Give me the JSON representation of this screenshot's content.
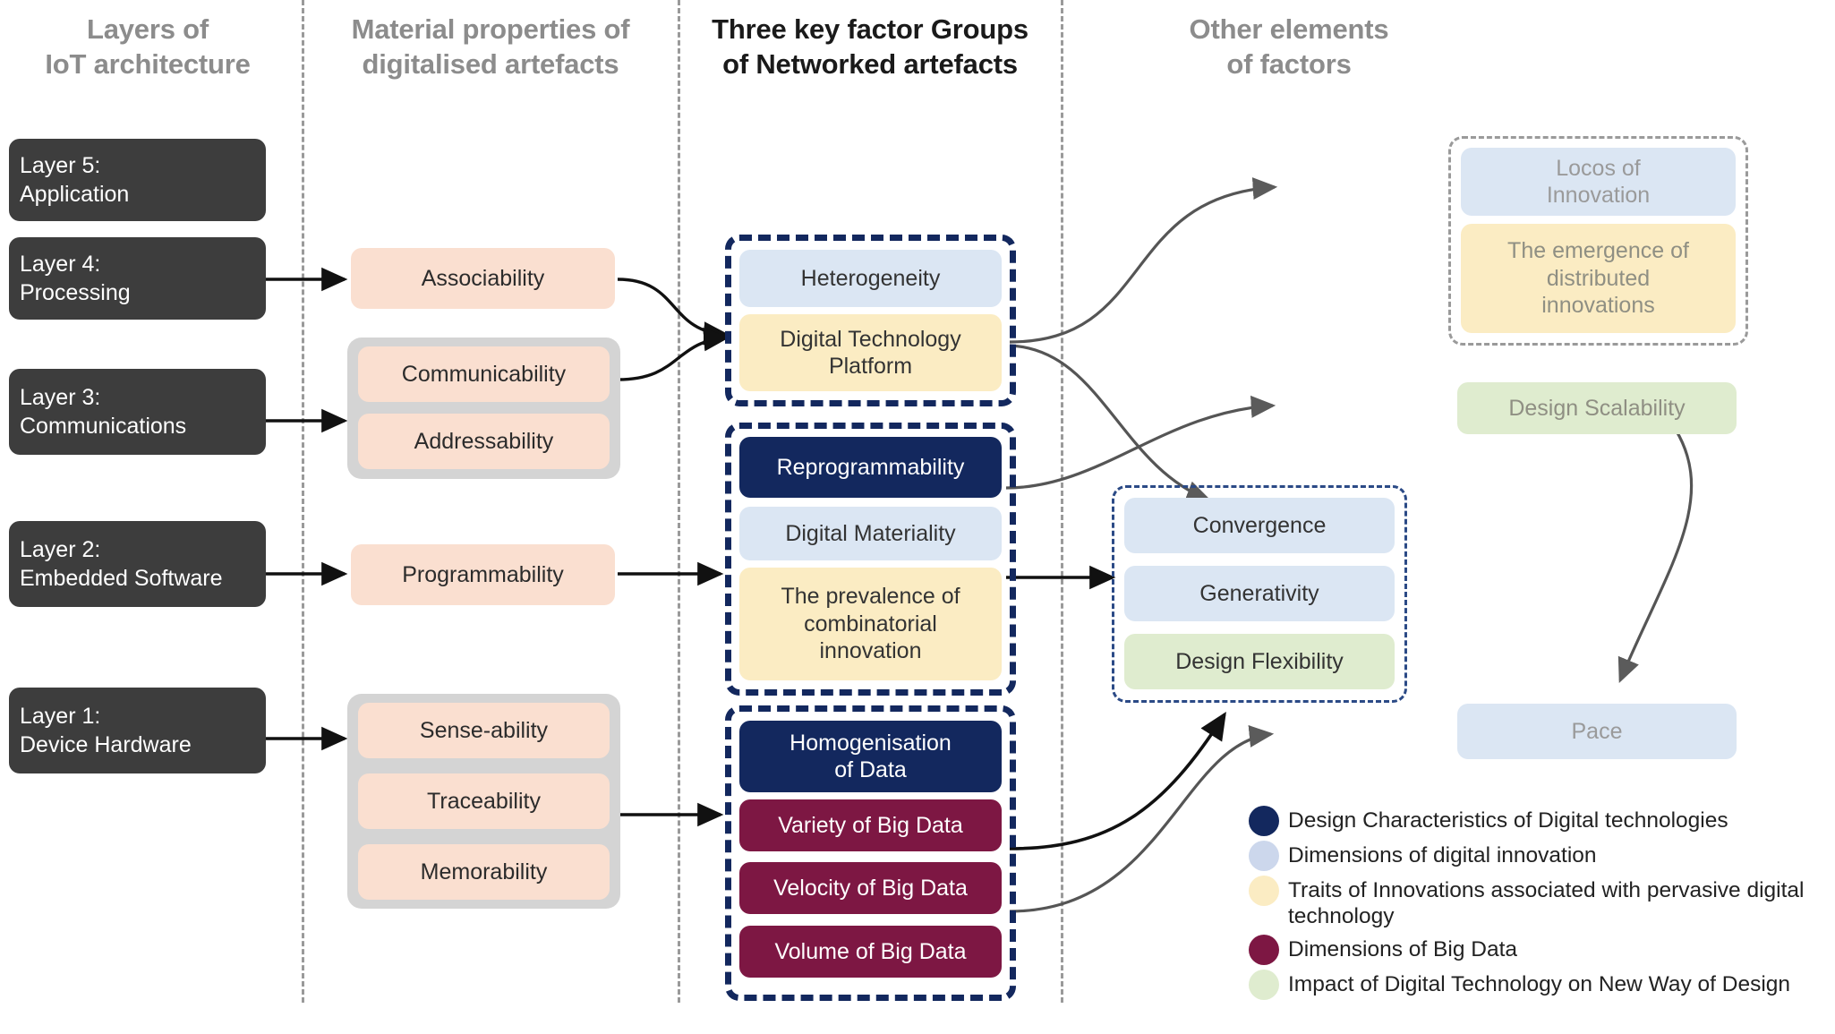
{
  "headers": [
    {
      "id": "layers",
      "label": "Layers of\nIoT architecture",
      "emphasis": "muted"
    },
    {
      "id": "material",
      "label": "Material properties of\ndigitalised artefacts",
      "emphasis": "muted"
    },
    {
      "id": "factors",
      "label": "Three key factor Groups\nof Networked artefacts",
      "emphasis": "strong"
    },
    {
      "id": "other",
      "label": "Other elements\nof factors",
      "emphasis": "muted"
    }
  ],
  "layers": [
    {
      "id": "layer5",
      "title": "Layer 5:",
      "sub": "Application"
    },
    {
      "id": "layer4",
      "title": "Layer 4:",
      "sub": "Processing"
    },
    {
      "id": "layer3",
      "title": "Layer 3:",
      "sub": "Communications"
    },
    {
      "id": "layer2",
      "title": "Layer 2:",
      "sub": "Embedded Software"
    },
    {
      "id": "layer1",
      "title": "Layer 1:",
      "sub": "Device Hardware"
    }
  ],
  "material_properties": [
    {
      "id": "associability",
      "label": "Associability"
    },
    {
      "id": "communicability",
      "label": "Communicability"
    },
    {
      "id": "addressability",
      "label": "Addressability"
    },
    {
      "id": "programmability",
      "label": "Programmability"
    },
    {
      "id": "sense-ability",
      "label": "Sense-ability"
    },
    {
      "id": "traceability",
      "label": "Traceability"
    },
    {
      "id": "memorability",
      "label": "Memorability"
    }
  ],
  "factor_groups": [
    {
      "id": "group1",
      "items": [
        {
          "id": "heterogeneity",
          "label": "Heterogeneity",
          "color": "lightblue"
        },
        {
          "id": "digital-technology-platform",
          "label": "Digital Technology\nPlatform",
          "color": "cream"
        }
      ]
    },
    {
      "id": "group2",
      "items": [
        {
          "id": "reprogrammability",
          "label": "Reprogrammability",
          "color": "navy"
        },
        {
          "id": "digital-materiality",
          "label": "Digital Materiality",
          "color": "lightblue"
        },
        {
          "id": "prevalence-combinatorial-innovation",
          "label": "The prevalence of\ncombinatorial\ninnovation",
          "color": "cream"
        }
      ]
    },
    {
      "id": "group3",
      "items": [
        {
          "id": "homogenisation-of-data",
          "label": "Homogenisation\nof Data",
          "color": "navy"
        },
        {
          "id": "variety-of-big-data",
          "label": "Variety of Big Data",
          "color": "maroon"
        },
        {
          "id": "velocity-of-big-data",
          "label": "Velocity of Big Data",
          "color": "maroon"
        },
        {
          "id": "volume-of-big-data",
          "label": "Volume of Big Data",
          "color": "maroon"
        }
      ]
    }
  ],
  "other_elements": {
    "locos_group": [
      {
        "id": "locos-of-innovation",
        "label": "Locos of\nInnovation",
        "color": "lightblue"
      },
      {
        "id": "emergence-distributed-innovations",
        "label": "The emergence of\ndistributed\ninnovations",
        "color": "cream"
      }
    ],
    "convergence_group": [
      {
        "id": "convergence",
        "label": "Convergence",
        "color": "lightblue"
      },
      {
        "id": "generativity",
        "label": "Generativity",
        "color": "lightblue"
      },
      {
        "id": "design-flexibility",
        "label": "Design Flexibility",
        "color": "lightgreen"
      }
    ],
    "standalone": [
      {
        "id": "design-scalability",
        "label": "Design Scalability",
        "color": "lightgreen"
      },
      {
        "id": "pace",
        "label": "Pace",
        "color": "lightblue"
      }
    ]
  },
  "legend": [
    {
      "id": "design-characteristics",
      "color": "#13285e",
      "label": "Design Characteristics of Digital technologies"
    },
    {
      "id": "dimensions-digital-innovation",
      "color": "#ccd7ec",
      "label": "Dimensions of digital innovation"
    },
    {
      "id": "traits-innovations",
      "color": "#fbecc3",
      "label": "Traits of Innovations associated with pervasive digital technology"
    },
    {
      "id": "dimensions-big-data",
      "color": "#7d1743",
      "label": "Dimensions of Big Data"
    },
    {
      "id": "impact-digital-technology",
      "color": "#dfeccf",
      "label": "Impact of Digital Technology on New Way of Design"
    }
  ],
  "colors": {
    "dark_box": "#3d3d3d",
    "peach": "#fadfd0",
    "navy": "#13285e",
    "maroon": "#7d1743",
    "light_blue": "#dbe6f3",
    "cream": "#fbecc3",
    "light_green": "#dfeccf",
    "gray_group": "#d4d4d4",
    "divider": "#9a9a9a"
  }
}
